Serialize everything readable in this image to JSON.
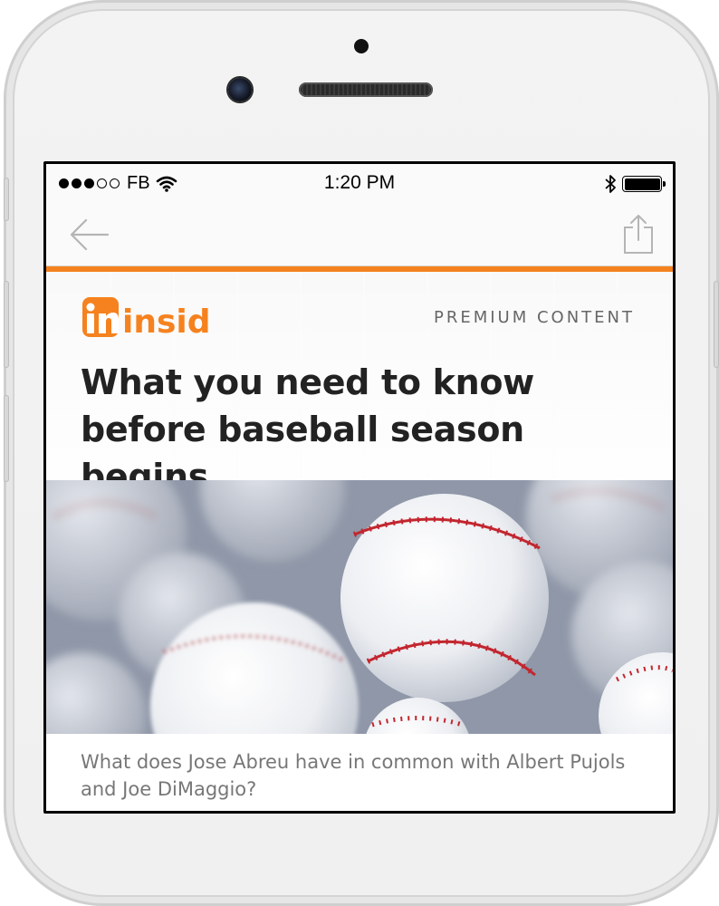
{
  "status_bar": {
    "carrier": "FB",
    "time": "1:20 PM",
    "signal_dots_filled": 3,
    "signal_dots_total": 5,
    "battery_level": 1.0
  },
  "nav": {
    "back_icon": "arrow-left-icon",
    "share_icon": "share-icon"
  },
  "brand": {
    "logo_text": "insider",
    "accent_color": "#f5821f",
    "label": "PREMIUM CONTENT"
  },
  "article": {
    "headline": "What you need to know before baseball season begins",
    "intro": "What does Jose Abreu have in common with Albert Pujols and Joe DiMaggio?"
  },
  "colors": {
    "accent": "#f5821f",
    "headline": "#222222",
    "body_text": "#777777"
  }
}
